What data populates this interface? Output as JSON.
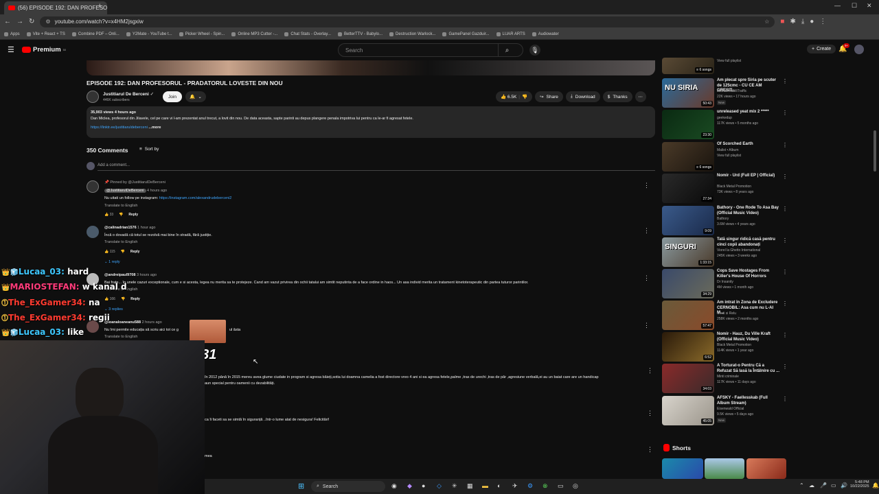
{
  "browser": {
    "tab_title": "(56) EPISODE 192: DAN PROFESO...",
    "new_tab_icon": "plus-icon",
    "url": "youtube.com/watch?v=x4HM2jsgxiw",
    "bookmarks": [
      "Apps",
      "Vite + React + TS",
      "Combine PDF – Onli...",
      "Y2Mate - YouTube t...",
      "Picker Wheel - Spin...",
      "Online MP3 Cutter -...",
      "Chat Stats - Overlay...",
      "BetterTTV - Babylo...",
      "Destruction Warlock...",
      "GamePanel Gazduir...",
      "LUAR ARTS",
      "Audiowater"
    ]
  },
  "header": {
    "logo_text": "Premium",
    "logo_badge": "50",
    "search_placeholder": "Search",
    "create_label": "Create",
    "notif_count": "9+"
  },
  "video": {
    "title": "EPISODE 192: DAN PROFESORUL - PRADATORUL LOVESTE DIN NOU",
    "channel": "Justitiarul De Berceni",
    "subscribers": "446K subscribers",
    "join_label": "Join",
    "likes": "6.5K",
    "share_label": "Share",
    "download_label": "Download",
    "thanks_label": "Thanks"
  },
  "description": {
    "stats": "35,903 views  4 hours ago",
    "text": "Dan Miclea, profesorul din Jilavele, cel pe care vi l-am prezentat anul trecut, a lovit din nou. De data aceasta, sapte parinti au depus plangere penala impotriva lui pentru ca le-ar fi agresat fetele.",
    "link": "https://linktr.ee/justitiaruldeberceni",
    "more": "...more"
  },
  "comments_header": {
    "count": "350 Comments",
    "sort_label": "Sort by",
    "add_placeholder": "Add a comment..."
  },
  "comments": [
    {
      "pinned": "Pinned by @JustitiarulDeBerceni",
      "author": "@JustitiarulDeBerceni",
      "time": "4 hours ago",
      "text_prefix": "Nu uitati un follow pe instagram: ",
      "link": "https://instagram.com/alexandrudeberceni2",
      "translate": "Translate to English",
      "likes": "33",
      "reply": "Reply"
    },
    {
      "author": "@calinadrian1576",
      "time": "1 hour ago",
      "text": "Încă o dovadă că totul se rezolvă mai bine în stradă, fără justiție.",
      "translate": "Translate to English",
      "likes": "115",
      "reply": "Reply",
      "replies": "1 reply"
    },
    {
      "author": "@andreipaul9708",
      "time": "3 hours ago",
      "text": "Bai frate... în unele cazuri exceptionale, cum e si acesta, legea nu merita sa te protejeze. Cand am vazut privirea din ochii tatalui am simtit neputinta de a face ordine in haos... Un asa individ merita un tratament kinetoterapeutic din partea tuturor parintilor.",
      "translate": "Translate to English",
      "likes": "166",
      "reply": "Reply",
      "replies": "3 replies"
    },
    {
      "author": "@ioanaloaneanu588",
      "time": "2 hours ago",
      "text_a": "Nu îmi permite educația să scriu aici tot ce g",
      "text_b": "ul ăsta",
      "translate": "Translate to English"
    }
  ],
  "partial_comments": [
    "în 2012 până în 2015 mereu avea glume ciudate in program si agresa băieți,sotia lui doamna camelia a fost directore vreo 4 ani si ea agresa fetele,palme ,tras de urechi ,tras de păr ,agresiune verbală,ei au un baiat  care are  un handicap",
    "aun special pentru oamenii  cu dezabilități.",
    "ca îi faceti sa se simtă în siguranță ..într-o lume atat de nesigura! Felicitări!",
    "mea"
  ],
  "recommendations": [
    {
      "title": "",
      "channel": "",
      "meta": "View full playlist",
      "badge": "6 songs",
      "colors": [
        "#5a4a35",
        "#2a2418"
      ]
    },
    {
      "title": "Am plecat spre Siria pe scuter de 125cmc - CU CE AM GRESIT...",
      "channel": "bucharestBilliTraffic",
      "meta": "22K views • 17 hours ago",
      "new": "New",
      "duration": "50:43",
      "thumb_text": "NU SIRIA",
      "colors": [
        "#2a6a9a",
        "#6a3a2a"
      ]
    },
    {
      "title": "unreleased yeat mix 2 *****",
      "channel": "geekedup",
      "meta": "117K views • 5 months ago",
      "duration": "23:30",
      "colors": [
        "#0a2a12",
        "#1a4a22"
      ]
    },
    {
      "title": "Of Scorched Earth",
      "channel": "Malist • Album",
      "meta": "View full playlist",
      "badge": "6 songs",
      "colors": [
        "#4a3a28",
        "#1a140e"
      ]
    },
    {
      "title": "Nomir - Urd (Full EP | Official)",
      "channel": "Black Metal Promotion",
      "meta": "73K views • 8 years ago",
      "duration": "27:34",
      "colors": [
        "#2a2a2a",
        "#0a0a0a"
      ]
    },
    {
      "title": "Bathory - One Rode To Asa Bay (Official Music Video)",
      "channel": "Bathory",
      "meta": "3.6M views • 4 years ago",
      "duration": "9:09",
      "colors": [
        "#3a5a8a",
        "#1a2a4a"
      ]
    },
    {
      "title": "Tată singur ridică casă pentru cinci copii abandonați",
      "channel": "Viorel la Ghetto International",
      "meta": "245K views • 3 weeks ago",
      "duration": "1:33:15",
      "thumb_text": "SINGURI",
      "colors": [
        "#8a9aa0",
        "#4a3a2a"
      ]
    },
    {
      "title": "Cops Save Hostages From Killer's House Of Horrors",
      "channel": "Dr Insanity",
      "meta": "4M views • 1 month ago",
      "duration": "34:29",
      "colors": [
        "#3a4a6a",
        "#6a6a5a"
      ]
    },
    {
      "title": "Am intrat în Zona de Excludere CERNOBIL: Asa cum nu L-AI M...",
      "channel": "Cristi si Relu",
      "meta": "258K views • 2 months ago",
      "duration": "57:47",
      "colors": [
        "#6a5a3a",
        "#8a4a2a"
      ]
    },
    {
      "title": "Nomir - Hauz, Du Ville Kraft (Official Music Video)",
      "channel": "Black Metal Promotion",
      "meta": "114K views • 1 year ago",
      "duration": "6:52",
      "colors": [
        "#2a1a0a",
        "#8a6a2a"
      ]
    },
    {
      "title": "A Torturat-o Pentru Că a Refuzat Să Iasă la Întâlnire cu ...",
      "channel": "Minti criminale",
      "meta": "117K views • 11 days ago",
      "duration": "34:03",
      "colors": [
        "#8a2a2a",
        "#3a2a2a"
      ]
    },
    {
      "title": "AFSKY - Faellesskab (Full Album Stream)",
      "channel": "Eisenwald Official",
      "meta": "9.5K views • 5 days ago",
      "new": "New",
      "duration": "45:05",
      "colors": [
        "#d8d4cc",
        "#9a948a"
      ]
    }
  ],
  "shorts_label": "Shorts",
  "overlay": {
    "chat": [
      {
        "user": "Lucaa_03:",
        "msg": "hard",
        "color": "#3ec8ff",
        "badge": "👑🧊"
      },
      {
        "user": "MARIOSTEFAN:",
        "msg": "w kanal d",
        "color": "#ff3b7a",
        "badge": "👑"
      },
      {
        "user": "The_ExGamer34:",
        "msg": "na",
        "color": "#ff3b30",
        "badge": "⓵"
      },
      {
        "user": "The_ExGamer34:",
        "msg": "regii",
        "color": "#ff3b30",
        "badge": "⓵"
      },
      {
        "user": "Lucaa_03:",
        "msg": "like",
        "color": "#3ec8ff",
        "badge": "👑🧊"
      }
    ],
    "multiplier": "x31"
  },
  "taskbar": {
    "search_label": "Search",
    "time": "5:48 PM",
    "date": "10/22/2025"
  }
}
